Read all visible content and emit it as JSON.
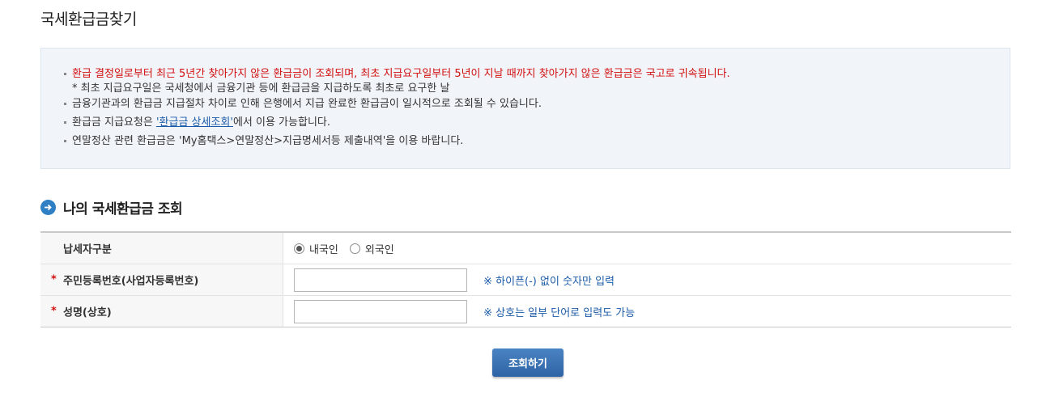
{
  "page": {
    "title": "국세환급금찾기"
  },
  "notice": {
    "items": [
      {
        "text": "환급 결정일로부터 최근 5년간 찾아가지 않은 환급금이 조회되며, 최초 지급요구일부터 5년이 지날 때까지 찾아가지 않은 환급금은 국고로 귀속됩니다."
      },
      {
        "text": "* 최초 지급요구일은 국세청에서 금융기관 등에 환급금을 지급하도록 최초로 요구한 날"
      },
      {
        "text": "금융기관과의 환급금 지급절차 차이로 인해 은행에서 지급 완료한 환급금이 일시적으로 조회될 수 있습니다."
      },
      {
        "prefix": "환급금 지급요청은 ",
        "link": "'환급금 상세조회'",
        "suffix": "에서 이용 가능합니다."
      },
      {
        "text": "연말정산 관련 환급금은 'My홈택스>연말정산>지급명세서등 제출내역'을 이용 바랍니다."
      }
    ]
  },
  "section": {
    "title": "나의 국세환급금 조회",
    "icon": "arrow-right-circle-icon"
  },
  "form": {
    "taxpayer_type": {
      "label": "납세자구분",
      "options": [
        {
          "label": "내국인",
          "selected": true
        },
        {
          "label": "외국인",
          "selected": false
        }
      ]
    },
    "id_number": {
      "required_mark": "*",
      "label": "주민등록번호(사업자등록번호)",
      "value": "",
      "hint": "※ 하이픈(-) 없이 숫자만 입력"
    },
    "name": {
      "required_mark": "*",
      "label": "성명(상호)",
      "value": "",
      "hint": "※ 상호는 일부 단어로 입력도 가능"
    }
  },
  "actions": {
    "submit_label": "조회하기"
  },
  "colors": {
    "required": "#d20f0f",
    "accent": "#2e64a5",
    "hint": "#1a5aa8",
    "notice_bg": "#f1f5fa"
  }
}
